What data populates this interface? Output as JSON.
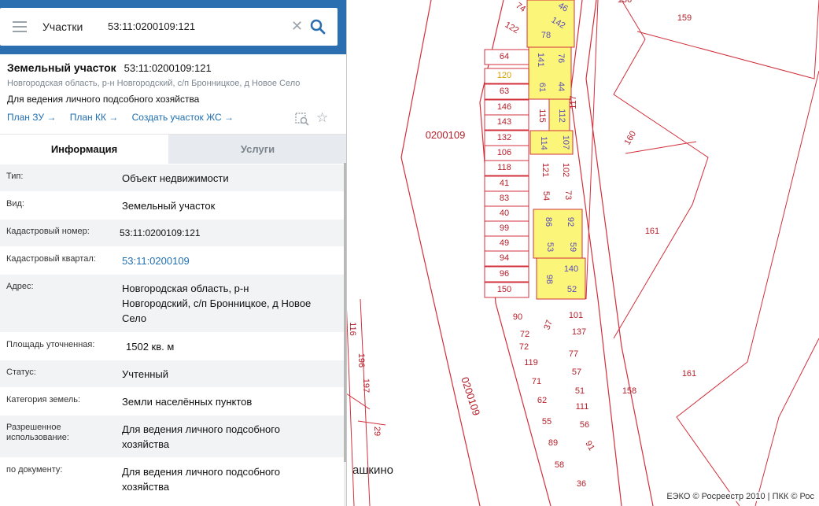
{
  "search": {
    "type_label": "Участки",
    "value": "53:11:0200109:121"
  },
  "card": {
    "title": "Земельный участок",
    "cadnum": "53:11:0200109:121",
    "address": "Новгородская область, р-н Новгородский, с/п Бронницкое, д Новое Село",
    "use": "Для ведения личного подсобного хозяйства",
    "links": [
      "План ЗУ →",
      "План КК →",
      "Создать участок ЖС →"
    ]
  },
  "tabs": [
    "Информация",
    "Услуги"
  ],
  "info": [
    {
      "label": "Тип:",
      "value": "Объект недвижимости"
    },
    {
      "label": "Вид:",
      "value": "Земельный участок"
    },
    {
      "label": "Кадастровый номер:",
      "value": "53:11:0200109:121"
    },
    {
      "label": "Кадастровый квартал:",
      "value": "53:11:0200109"
    },
    {
      "label": "Адрес:",
      "value": "Новгородская область, р-н Новгородский, с/п Бронницкое, д Новое Село"
    },
    {
      "label": "Площадь уточненная:",
      "value": "1502 кв. м"
    },
    {
      "label": "Статус:",
      "value": "Учтенный"
    },
    {
      "label": "Категория земель:",
      "value": "Земли населённых пунктов"
    },
    {
      "label": "Разрешенное использование:",
      "value": "Для ведения личного подсобного хозяйства"
    },
    {
      "label": "по документу:",
      "value": "Для ведения личного подсобного хозяйства"
    }
  ],
  "map": {
    "quarter_labels": [
      "0200109",
      "0200109"
    ],
    "place_label": "ашкино",
    "copyright": "ЕЭКО © Росреестр 2010 | ПКК © Рос",
    "selected_plot": "120",
    "left_column": [
      "74",
      "122",
      "64",
      "120",
      "63",
      "146",
      "143",
      "132",
      "106",
      "118",
      "41",
      "83",
      "40",
      "99",
      "49",
      "94",
      "96",
      "150"
    ],
    "mid_column": [
      "46",
      "142",
      "78",
      "141",
      "76",
      "61",
      "44",
      "115",
      "112",
      "114",
      "107",
      "121",
      "102",
      "54",
      "73",
      "86",
      "92",
      "53",
      "59",
      "98",
      "140",
      "52"
    ],
    "right_column": [
      "117"
    ],
    "lower_left": [
      "90",
      "72",
      "72",
      "119",
      "71",
      "62",
      "55",
      "89",
      "58"
    ],
    "lower_right": [
      "37",
      "101",
      "137",
      "77",
      "57",
      "51",
      "111",
      "56",
      "91",
      "36"
    ],
    "far_right": [
      "159",
      "160",
      "161",
      "161",
      "158",
      "136"
    ],
    "edge_left": [
      "116",
      "196",
      "197",
      "29"
    ]
  },
  "colors": {
    "header": "#2c6fb0",
    "link": "#1f6fb2",
    "plot_line": "#d2303c",
    "highlight": "#fbf67a"
  }
}
